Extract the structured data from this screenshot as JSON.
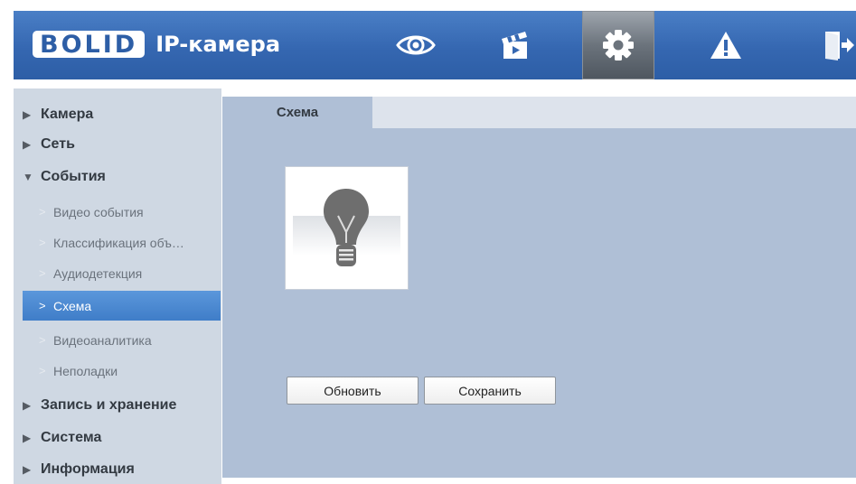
{
  "header": {
    "brand": "BOLID",
    "title": "IP-камера",
    "nav": [
      {
        "name": "live-view",
        "icon": "eye-icon"
      },
      {
        "name": "playback",
        "icon": "clapperboard-icon"
      },
      {
        "name": "settings",
        "icon": "gear-icon",
        "active": true
      },
      {
        "name": "alarm",
        "icon": "warning-icon"
      },
      {
        "name": "logout",
        "icon": "exit-icon"
      }
    ]
  },
  "sidebar": {
    "camera": "Камера",
    "network": "Сеть",
    "events": "События",
    "events_items": [
      "Видео события",
      "Классификация объ…",
      "Аудиодетекция",
      "Схема",
      "Видеоаналитика",
      "Неполадки"
    ],
    "active_item": "Схема",
    "storage": "Запись и хранение",
    "system": "Система",
    "info": "Информация"
  },
  "content": {
    "tab": "Схема",
    "scheme_icon": "lightbulb-icon",
    "refresh_button": "Обновить",
    "save_button": "Сохранить"
  },
  "colors": {
    "header": "#3567b1",
    "sidebar": "#cfd8e3",
    "content": "#afbfd6",
    "active_item": "#4a86d0"
  }
}
